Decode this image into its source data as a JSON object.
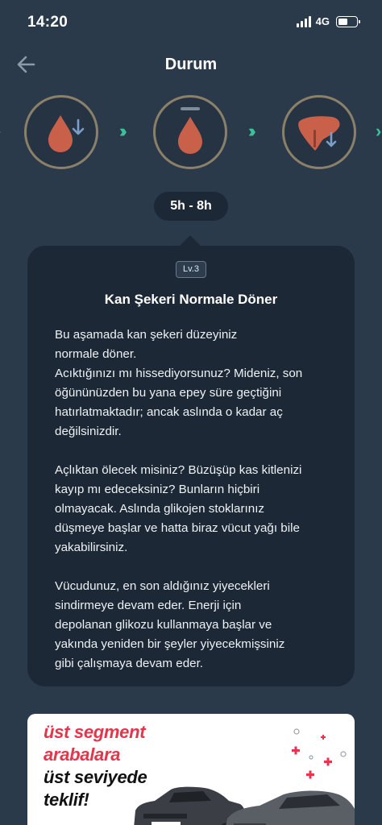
{
  "status_bar": {
    "time": "14:20",
    "network": "4G"
  },
  "header": {
    "title": "Durum",
    "back_icon": "arrow-left-icon"
  },
  "stages": [
    {
      "icon": "blood-drop-down-icon",
      "state": "past"
    },
    {
      "icon": "blood-drop-level-icon",
      "state": "current"
    },
    {
      "icon": "liver-down-icon",
      "state": "next"
    }
  ],
  "time_range": "5h - 8h",
  "card": {
    "level": "Lv.3",
    "title": "Kan Şekeri Normale Döner",
    "paragraphs": [
      "Bu aşamada kan şekeri düzeyiniz\nnormale döner.\nAcıktığınızı mı hissediyorsunuz? Mideniz, son\nöğününüzden bu yana epey süre geçtiğini\nhatırlatmaktadır; ancak aslında o kadar aç\ndeğilsinizdir.",
      "Açlıktan ölecek misiniz? Büzüşüp kas kitlenizi\nkayıp mı edeceksiniz? Bunların hiçbiri\nolmayacak. Aslında glikojen stoklarınız\ndüşmeye başlar ve hatta biraz vücut yağı bile\nyakabilirsiniz.",
      "Vücudunuz, en son aldığınız yiyecekleri\nsindirmeye devam eder. Enerji için\ndepolanan glikozu kullanmaya başlar ve\nyakında yeniden bir şeyler yiyecekmişsiniz\ngibi çalışmaya devam eder."
    ]
  },
  "ad": {
    "line1": "üst segment",
    "line2": "arabalara",
    "line3": "üst seviyede",
    "line4": "teklif!"
  },
  "colors": {
    "background": "#2a3a4b",
    "card": "#1c2836",
    "accent_green": "#39c39a",
    "stage_ring": "#8b8168",
    "drop": "#c9604a",
    "ad_red": "#e5344b"
  }
}
